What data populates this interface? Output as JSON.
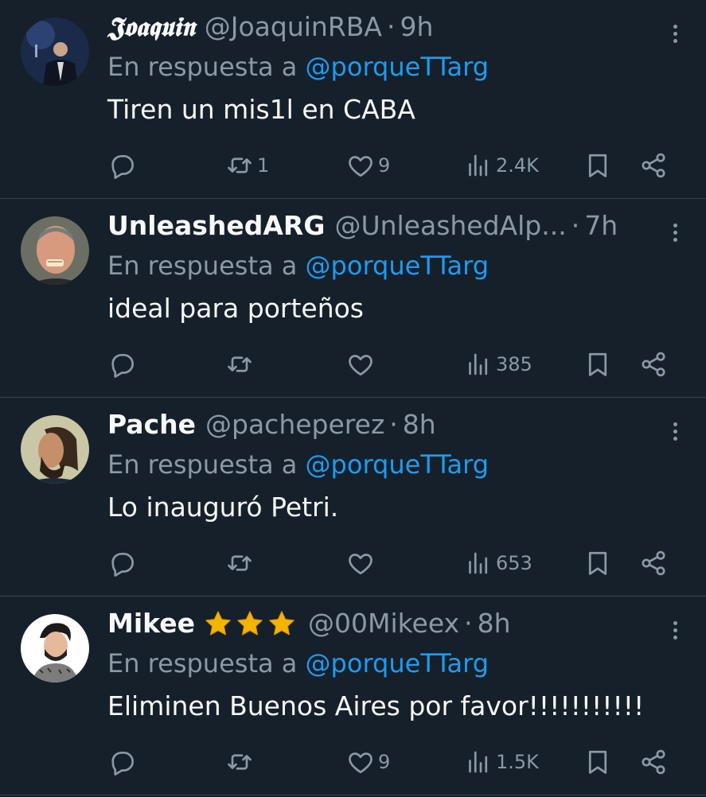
{
  "theme": {
    "background": "#15202b",
    "text": "#f7f9f9",
    "secondary_text": "#8b98a5",
    "link": "#1d9bf0",
    "divider": "#38444d",
    "star": "#f5b400"
  },
  "icons": {
    "reply": "speech-bubble-icon",
    "retweet": "retweet-arrows-icon",
    "like": "heart-icon",
    "views": "bar-chart-icon",
    "bookmark": "bookmark-icon",
    "share": "share-nodes-icon",
    "more": "vertical-dots-icon"
  },
  "tweets": [
    {
      "name": "𝕵𝖔𝖆𝖖𝖚𝖎𝖓",
      "handle": "@JoaquinRBA",
      "separator": "·",
      "time": "9h",
      "reply_prefix": "En respuesta a",
      "reply_mention": "@porqueTTarg",
      "text": "Tiren un mis1l en CABA",
      "replies": "",
      "retweets": "1",
      "likes": "9",
      "views": "2.4K"
    },
    {
      "name": "UnleashedARG",
      "handle": "@UnleashedAlp...",
      "separator": "·",
      "time": "7h",
      "reply_prefix": "En respuesta a",
      "reply_mention": "@porqueTTarg",
      "text": "ideal para porteños",
      "replies": "",
      "retweets": "",
      "likes": "",
      "views": "385"
    },
    {
      "name": "Pache",
      "handle": "@pacheperez",
      "separator": "·",
      "time": "8h",
      "reply_prefix": "En respuesta a",
      "reply_mention": "@porqueTTarg",
      "text": "Lo inauguró Petri.",
      "replies": "",
      "retweets": "",
      "likes": "",
      "views": "653"
    },
    {
      "name": "Mikee",
      "handle": "@00Mikeex",
      "separator": "·",
      "time": "8h",
      "reply_prefix": "En respuesta a",
      "reply_mention": "@porqueTTarg",
      "text": "Eliminen Buenos Aires por favor!!!!!!!!!!!",
      "replies": "",
      "retweets": "",
      "likes": "9",
      "views": "1.5K"
    }
  ]
}
